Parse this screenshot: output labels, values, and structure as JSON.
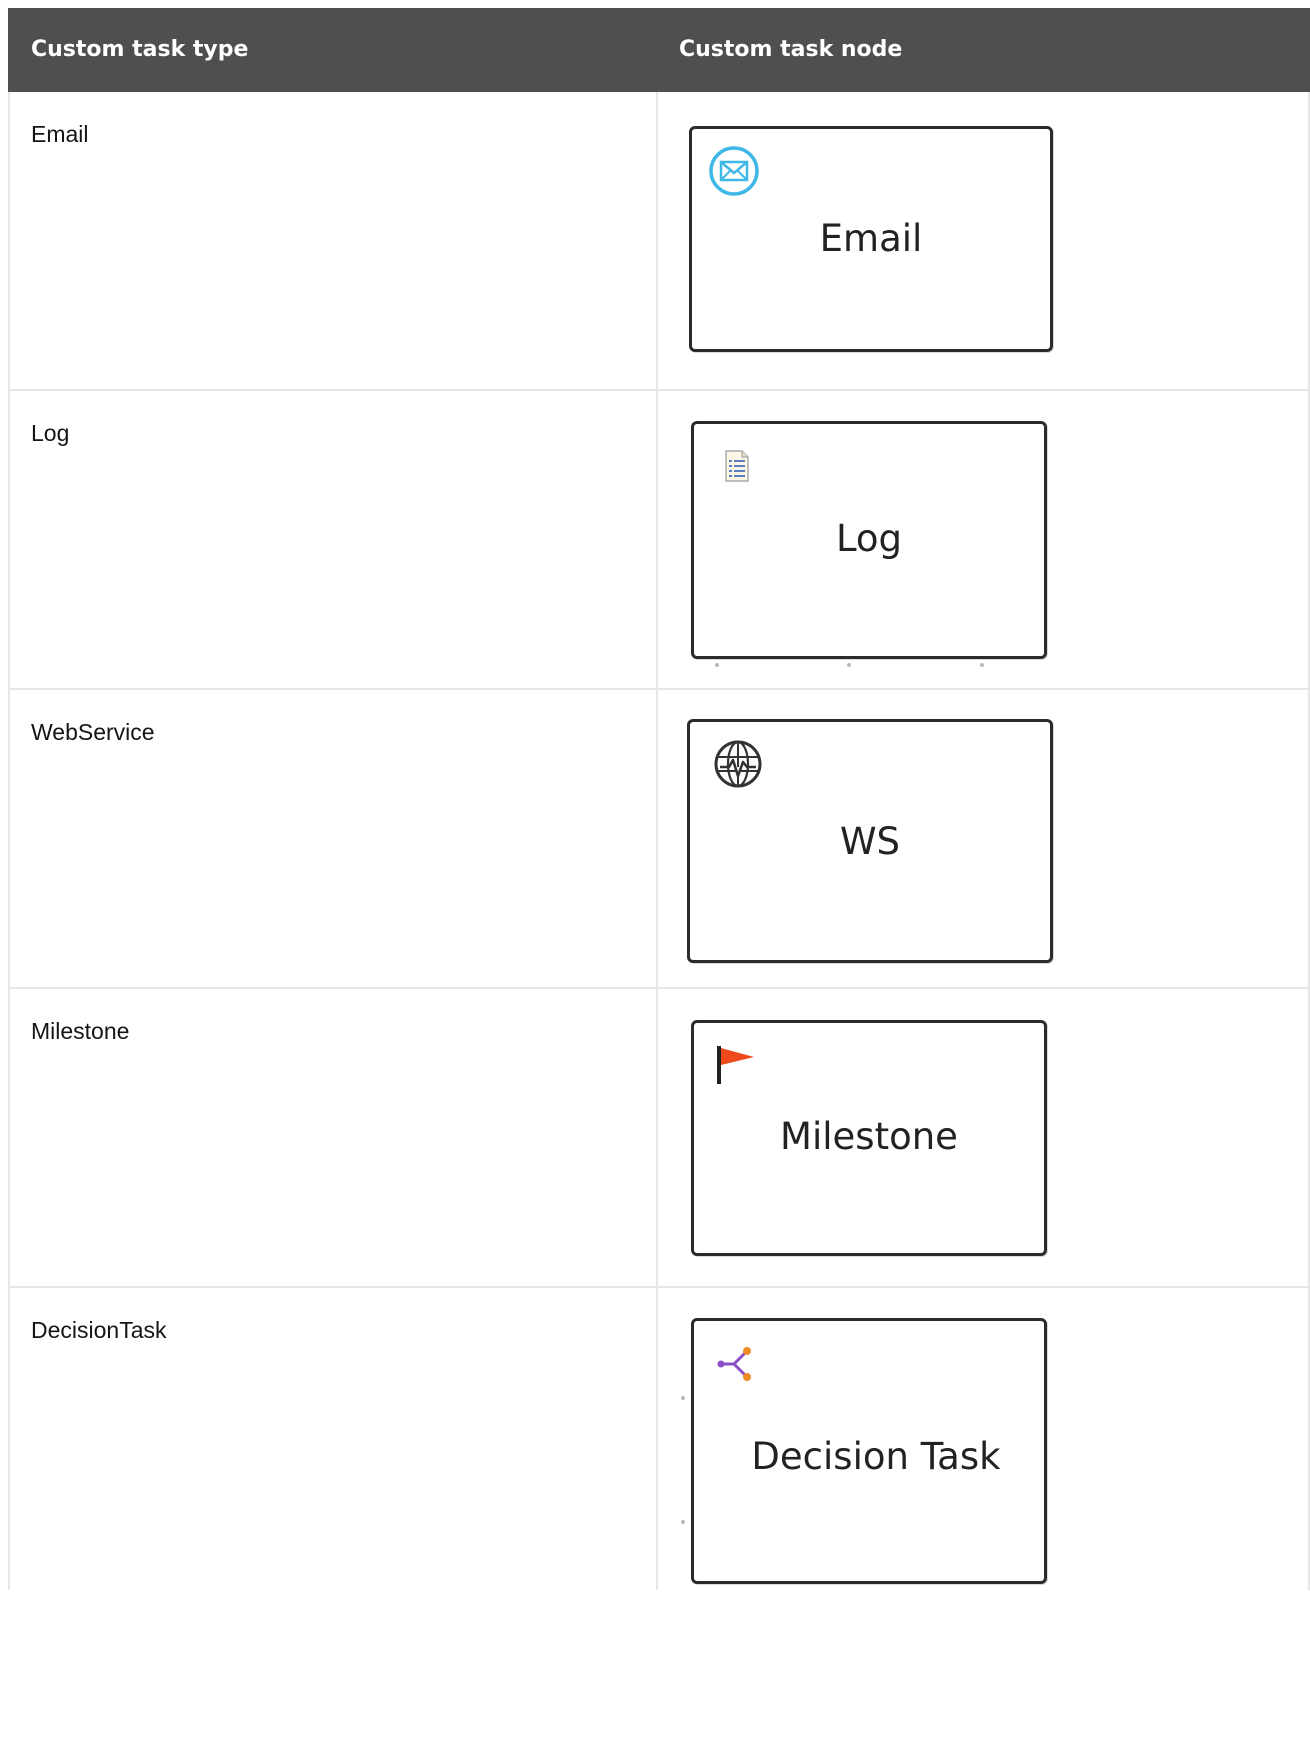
{
  "table": {
    "headers": [
      "Custom task type",
      "Custom task node"
    ],
    "rows": [
      {
        "type": "Email",
        "node_label": "Email",
        "icon": "envelope-icon",
        "icon_color": "#3fb8e8"
      },
      {
        "type": "Log",
        "node_label": "Log",
        "icon": "document-list-icon",
        "icon_color": "#5a7fc0"
      },
      {
        "type": "WebService",
        "node_label": "WS",
        "icon": "globe-pulse-icon",
        "icon_color": "#333333"
      },
      {
        "type": "Milestone",
        "node_label": "Milestone",
        "icon": "flag-icon",
        "icon_color": "#ee4a1c"
      },
      {
        "type": "DecisionTask",
        "node_label": "Decision Task",
        "icon": "decision-branch-icon",
        "icon_color": "#8a4fc4"
      }
    ]
  },
  "colors": {
    "header_bg": "#4f4f4f",
    "header_text": "#ffffff",
    "grid_line": "#e6e6e6",
    "node_border": "#2b2b2b"
  }
}
